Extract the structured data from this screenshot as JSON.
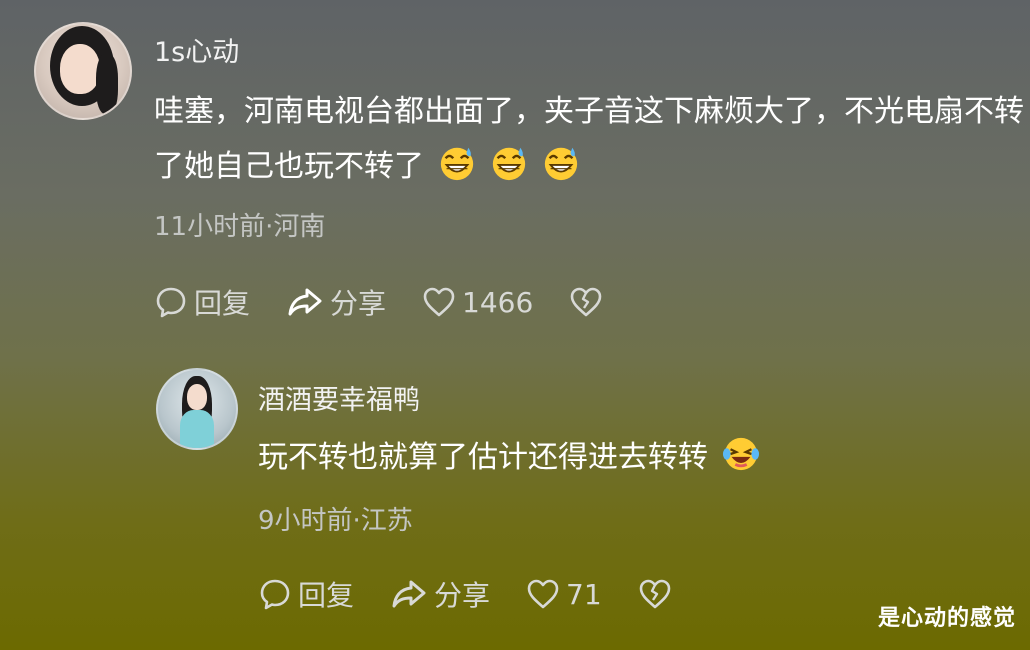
{
  "comments": [
    {
      "username": "1s心动",
      "text": "哇塞，河南电视台都出面了，夹子音这下麻烦大了，不光电扇不转了她自己也玩不转了",
      "emojis": [
        "grinning-sweat-emoji",
        "grinning-sweat-emoji",
        "grinning-sweat-emoji"
      ],
      "meta": "11小时前·河南",
      "actions": {
        "reply": "回复",
        "share": "分享",
        "likes": "1466"
      }
    },
    {
      "username": "酒酒要幸福鸭",
      "text": "玩不转也就算了估计还得进去转转",
      "emojis": [
        "laughing-tears-emoji"
      ],
      "meta": "9小时前·江苏",
      "actions": {
        "reply": "回复",
        "share": "分享",
        "likes": "71"
      }
    }
  ],
  "watermark": "是心动的感觉",
  "icons": [
    "reply-bubble-icon",
    "share-arrow-icon",
    "heart-icon",
    "broken-heart-icon"
  ],
  "colors": {
    "emoji_yellow": "#ffcc33",
    "sweat_blue": "#5bb8f5"
  }
}
